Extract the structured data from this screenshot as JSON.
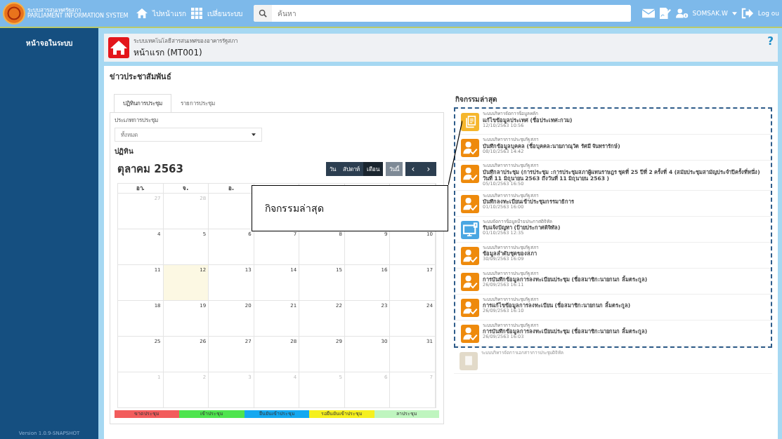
{
  "header": {
    "logo_title": "ระบบสารสนเทศรัฐสภา",
    "logo_subtitle": "PARLIAMENT INFORMATION SYSTEM",
    "home_link": "ไปหน้าแรก",
    "switch_link": "เปลี่ยนระบบ",
    "search": {
      "placeholder": "ค้นหา"
    },
    "user": "SOMSAK.W",
    "logout": "Log ou"
  },
  "sidebar": {
    "title": "หน้าจอในระบบ",
    "version": "Version 1.0.9-SNAPSHOT"
  },
  "page_header": {
    "system": "ระบบเทคโนโลยีสารสนเทศของอาคารรัฐสภา",
    "title": "หน้าแรก (MT001)",
    "help": "?"
  },
  "section_title": "ข่าวประชาสัมพันธ์",
  "tabs": [
    {
      "label": "ปฏิทินการประชุม",
      "selected": true
    },
    {
      "label": "รายการประชุม",
      "selected": false
    }
  ],
  "filter": {
    "label": "ประเภทการประชุม",
    "value": "ทั้งหมด"
  },
  "calendar": {
    "heading": "ปฏิทิน",
    "month": "ตุลาคม 2563",
    "views": [
      {
        "label": "วัน",
        "selected": false
      },
      {
        "label": "สัปดาห์",
        "selected": false
      },
      {
        "label": "เดือน",
        "selected": true
      }
    ],
    "today_button": {
      "label": "วันนี้",
      "disabled": true
    },
    "prev": "‹",
    "next": "›",
    "weekdays": [
      "อา.",
      "จ.",
      "อ."
    ],
    "weeks": [
      [
        {
          "day": "27",
          "other_month": true
        },
        {
          "day": "28",
          "other_month": true
        }
      ],
      [
        {
          "day": "4",
          "other_month": false
        },
        {
          "day": "5",
          "other_month": false
        },
        {
          "day": "6",
          "other_month": false
        },
        {
          "day": "7",
          "other_month": false
        },
        {
          "day": "8",
          "other_month": false
        },
        {
          "day": "9",
          "other_month": false
        },
        {
          "day": "10",
          "other_month": false
        }
      ],
      [
        {
          "day": "11",
          "other_month": false
        },
        {
          "day": "12",
          "other_month": false,
          "today": true
        },
        {
          "day": "13",
          "other_month": false
        },
        {
          "day": "14",
          "other_month": false
        },
        {
          "day": "15",
          "other_month": false
        },
        {
          "day": "16",
          "other_month": false
        },
        {
          "day": "17",
          "other_month": false
        }
      ],
      [
        {
          "day": "18",
          "other_month": false
        },
        {
          "day": "19",
          "other_month": false
        },
        {
          "day": "20",
          "other_month": false
        },
        {
          "day": "21",
          "other_month": false
        },
        {
          "day": "22",
          "other_month": false
        },
        {
          "day": "23",
          "other_month": false
        },
        {
          "day": "24",
          "other_month": false
        }
      ],
      [
        {
          "day": "25",
          "other_month": false
        },
        {
          "day": "26",
          "other_month": false
        },
        {
          "day": "27",
          "other_month": false
        },
        {
          "day": "28",
          "other_month": false
        },
        {
          "day": "29",
          "other_month": false
        },
        {
          "day": "30",
          "other_month": false
        },
        {
          "day": "31",
          "other_month": false
        }
      ],
      [
        {
          "day": "1",
          "other_month": true
        },
        {
          "day": "2",
          "other_month": true
        },
        {
          "day": "3",
          "other_month": true
        },
        {
          "day": "4",
          "other_month": true
        },
        {
          "day": "5",
          "other_month": true
        },
        {
          "day": "6",
          "other_month": true
        },
        {
          "day": "7",
          "other_month": true
        }
      ]
    ],
    "legend": [
      {
        "label": "ขาดประชุม",
        "color": "#f25c5c"
      },
      {
        "label": "เข้าประชุม",
        "color": "#4ee44e"
      },
      {
        "label": "ยืนยันเข้าประชุม",
        "color": "#14a8f0"
      },
      {
        "label": "รอยืนยันเข้าประชุม",
        "color": "#f5f01e"
      },
      {
        "label": "ลาประชุม",
        "color": "#bff5bf"
      }
    ]
  },
  "callout": {
    "text": "กิจกรรมล่าสุด"
  },
  "activity": {
    "title": "กิจกรรมล่าสุด",
    "items": [
      {
        "kind": "document",
        "system": "ระบบบริหารจัดการข้อมูลหลัก",
        "title": "แก้ไขข้อมูลประเทศ (ชื่อประเทศ:กวม)",
        "time": "12/10/2563 10:56",
        "highlighted": true
      },
      {
        "kind": "person",
        "system": "ระบบบริหารการประชุมรัฐสภา",
        "title": "บันทึกข้อมูลบุคคล (ชื่อบุคคล:นายภาณุวัต รัศมี จันทรารักษ์)",
        "time": "08/10/2563 14:42",
        "highlighted": true
      },
      {
        "kind": "person",
        "system": "ระบบบริหารการประชุมรัฐสภา",
        "title": "บันทึกลาประชุม (การประชุม :การประชุมสภาผู้แทนราษฎร ชุดที่ 25 ปีที่ 2 ครั้งที่ 4 (สมัยประชุมสามัญประจำปีครั้งที่หนึ่ง) วันที่ 11 มิถุนายน 2563 ถึงวันที่ 11 มิถุนายน 2563 )",
        "time": "05/10/2563 16:50",
        "highlighted": true
      },
      {
        "kind": "person",
        "system": "ระบบบริหารการประชุมรัฐสภา",
        "title": "บันทึกลงทะเบียนเข้าประชุมกรรมาธิการ",
        "time": "01/10/2563 16:00",
        "highlighted": true
      },
      {
        "kind": "monitor",
        "system": "ระบบจัดการข้อมูลป้ายประกาศดิจิทัล",
        "title": "รับแจ้งปัญหา (ป้ายประกาศดิจิทัล)",
        "time": "01/10/2563 12:35",
        "highlighted": true
      },
      {
        "kind": "person",
        "system": "ระบบบริหารการประชุมรัฐสภา",
        "title": "ข้อมูลลำดับชุดของสภา",
        "time": "30/09/2563 16:09",
        "highlighted": true
      },
      {
        "kind": "person",
        "system": "ระบบบริหารการประชุมรัฐสภา",
        "title": "การบันทึกข้อมูลการลงทะเบียนประชุม (ชื่อสมาชิก:นายกนก ลิ้มตระกูล)",
        "time": "26/09/2563 16:11",
        "highlighted": true
      },
      {
        "kind": "person",
        "system": "ระบบบริหารการประชุมรัฐสภา",
        "title": "การแก้ไขข้อมูลการลงทะเบียน (ชื่อสมาชิก:นายกนก ลิ้มตระกูล)",
        "time": "26/09/2563 16:10",
        "highlighted": true
      },
      {
        "kind": "person",
        "system": "ระบบบริหารการประชุมรัฐสภา",
        "title": "การบันทึกข้อมูลการลงทะเบียนประชุม (ชื่อสมาชิก:นายกนก ลิ้มตระกูล)",
        "time": "26/09/2563 16:03",
        "highlighted": true
      },
      {
        "kind": "file",
        "system": "ระบบบริหารจัดการเอกสารการประชุมดิจิทัล",
        "highlighted": false
      }
    ]
  }
}
